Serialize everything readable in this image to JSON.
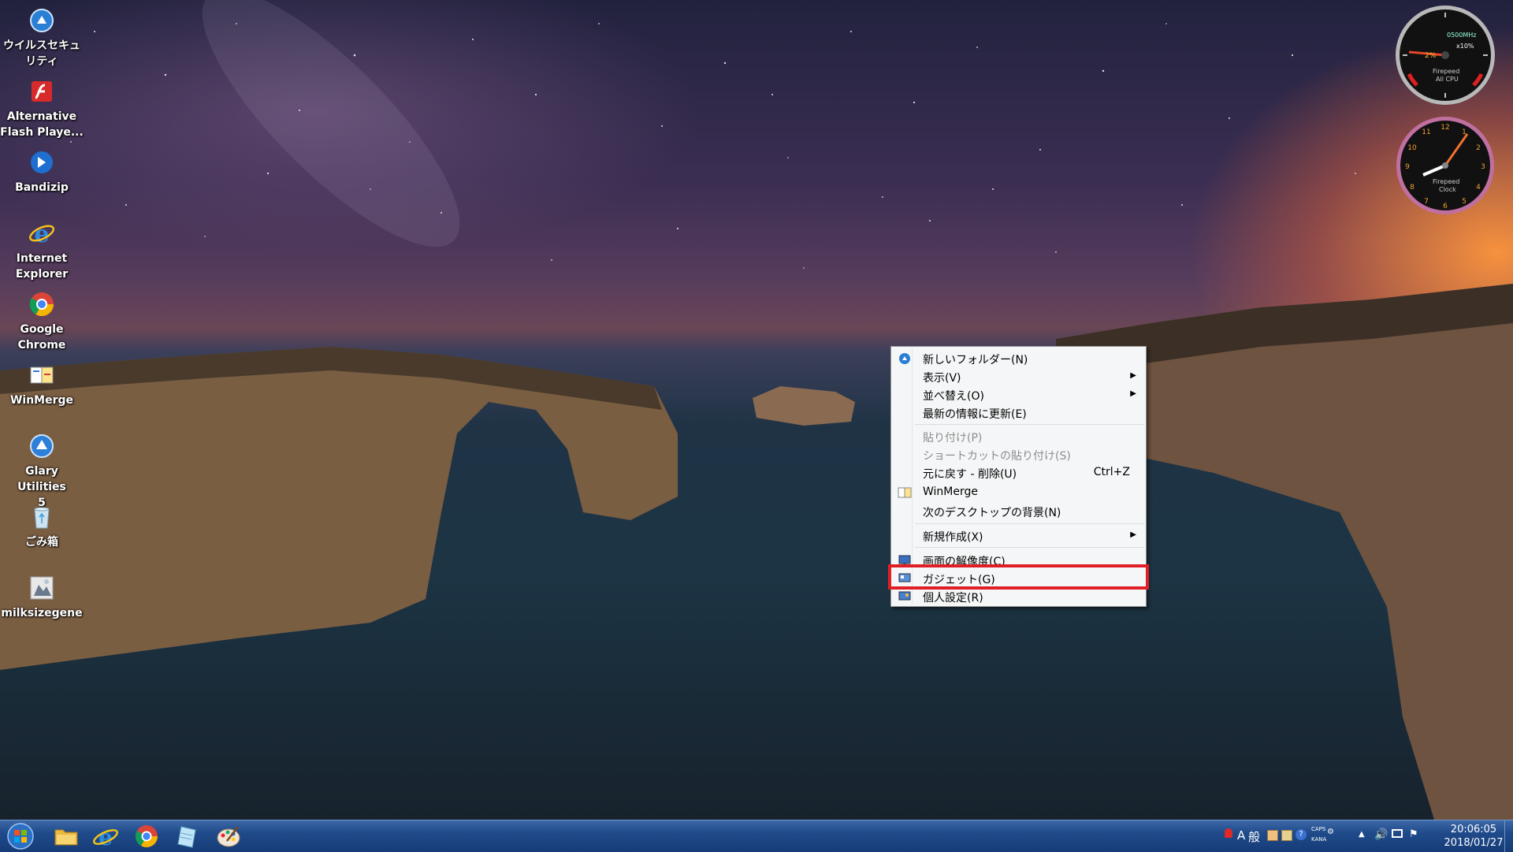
{
  "desktop": {
    "icons": [
      {
        "label": "ウイルスセキュ\nリティ",
        "icon": "shield-shortcut-icon"
      },
      {
        "label": "Alternative\nFlash Playe...",
        "icon": "flash-player-icon"
      },
      {
        "label": "Bandizip",
        "icon": "bandizip-icon"
      },
      {
        "label": "Internet\nExplorer",
        "icon": "internet-explorer-icon"
      },
      {
        "label": "Google\nChrome",
        "icon": "chrome-icon"
      },
      {
        "label": "WinMerge",
        "icon": "winmerge-icon"
      },
      {
        "label": "Glary Utilities\n5",
        "icon": "glary-utilities-icon"
      },
      {
        "label": "ごみ箱",
        "icon": "recycle-bin-icon"
      },
      {
        "label": "milksizegene",
        "icon": "milksizegene-icon"
      }
    ]
  },
  "gadgets": {
    "cpu": {
      "speed": "0500MHz",
      "percent": "x10%",
      "brand": "Firepeed",
      "caption": "All CPU",
      "value": "2%"
    },
    "clock": {
      "brand": "Firepeed",
      "caption": "Clock"
    }
  },
  "context_menu": {
    "items": [
      {
        "label": "新しいフォルダー(N)",
        "icon": "new-folder-icon"
      },
      {
        "label": "表示(V)",
        "submenu": true
      },
      {
        "label": "並べ替え(O)",
        "submenu": true
      },
      {
        "label": "最新の情報に更新(E)"
      },
      {
        "label": "貼り付け(P)",
        "disabled": true
      },
      {
        "label": "ショートカットの貼り付け(S)",
        "disabled": true
      },
      {
        "label": "元に戻す - 削除(U)",
        "shortcut": "Ctrl+Z"
      },
      {
        "label": "WinMerge",
        "icon": "winmerge-icon"
      },
      {
        "label": "次のデスクトップの背景(N)"
      },
      {
        "label": "新規作成(X)",
        "submenu": true
      },
      {
        "label": "画面の解像度(C)",
        "icon": "screen-resolution-icon"
      },
      {
        "label": "ガジェット(G)",
        "icon": "gadgets-icon",
        "highlighted": true
      },
      {
        "label": "個人設定(R)",
        "icon": "personalize-icon"
      }
    ]
  },
  "taskbar": {
    "pinned": [
      "explorer-folder-icon",
      "internet-explorer-icon",
      "chrome-icon",
      "notepad-icon",
      "paint-icon"
    ],
    "tray": {
      "ime_mode": "A",
      "ime_label": "般",
      "caps": "CAPS",
      "kana": "KANA"
    },
    "clock": {
      "time": "20:06:05",
      "date": "2018/01/27"
    }
  },
  "colors": {
    "highlight_border": "#e01e25",
    "taskbar": "#1f4a8a",
    "menu_bg": "#f5f6f7"
  }
}
